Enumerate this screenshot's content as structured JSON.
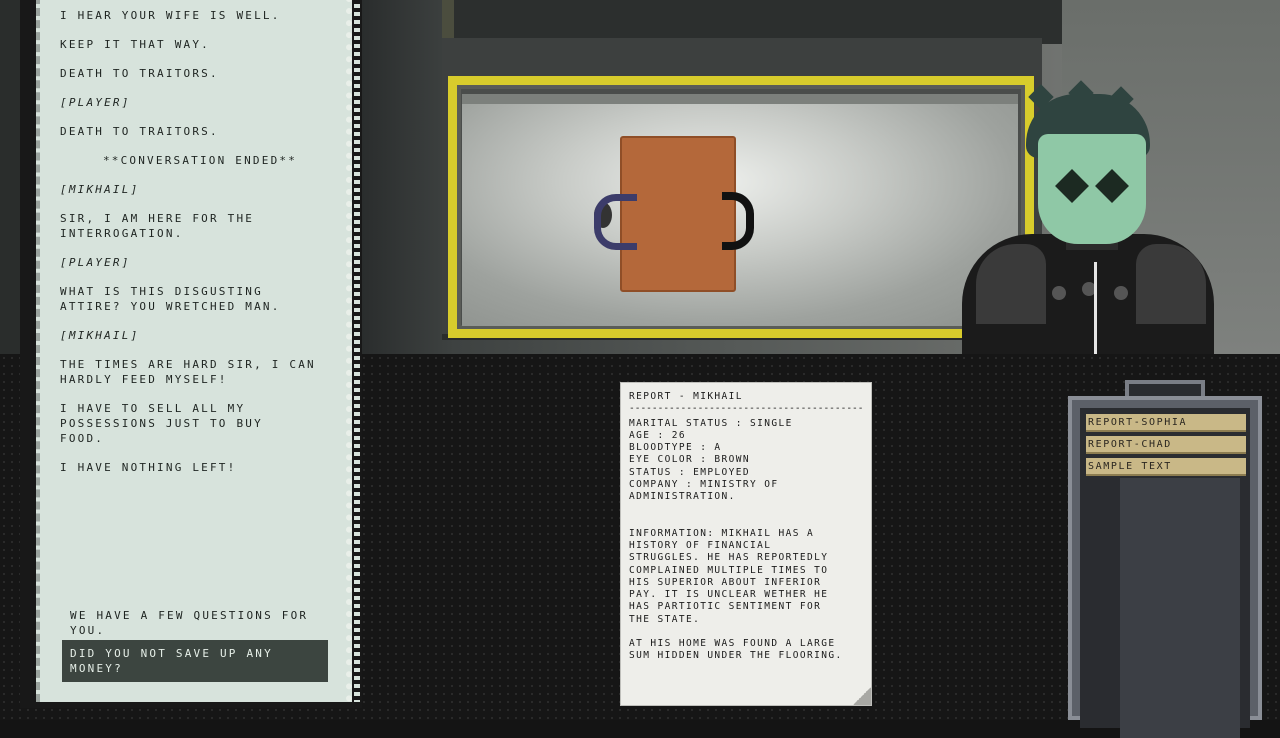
{
  "dialogue": {
    "lines": [
      {
        "text": "I hear your wife is well.",
        "style": "normal"
      },
      {
        "text": "Keep it that way.",
        "style": "normal"
      },
      {
        "text": "Death to traitors.",
        "style": "normal"
      },
      {
        "text": "[PLAYER]",
        "style": "ital"
      },
      {
        "text": "Death to traitors.",
        "style": "normal"
      },
      {
        "text": "**CONVERSATION ENDED**",
        "style": "center"
      },
      {
        "text": "[MIKHAIL]",
        "style": "ital"
      },
      {
        "text": "Sir, I am here for the\ninterrogation.",
        "style": "normal"
      },
      {
        "text": "[PLAYER]",
        "style": "ital"
      },
      {
        "text": "What is this disgusting\nattire? You wretched man.",
        "style": "normal"
      },
      {
        "text": "[MIKHAIL]",
        "style": "ital"
      },
      {
        "text": "The times are hard sir, I can\nhardly feed myself!",
        "style": "normal"
      },
      {
        "text": "I have to sell all my\npossessions just to buy\nfood.",
        "style": "normal"
      },
      {
        "text": "I have nothing left!",
        "style": "normal"
      }
    ],
    "options": [
      {
        "text": "We have a few questions\nfor you.",
        "selected": false
      },
      {
        "text": "Did you not save up any\nmoney?",
        "selected": true
      }
    ]
  },
  "report": {
    "title": "REPORT - MIKHAIL",
    "divider": "------------------------------------------",
    "fields": "MARITAL STATUS : SINGLE\nAGE : 26\nBLOODTYPE : A\nEYE COLOR : BROWN\nSTATUS : EMPLOYED\nCOMPANY : MINISTRY OF\nADMINISTRATION.",
    "information": "INFORMATION: MIKHAIL HAS A\nHISTORY OF FINANCIAL\nSTRUGGLES. HE HAS REPORTEDLY\nCOMPLAINED MULTIPLE TIMES TO\nHIS SUPERIOR ABOUT INFERIOR\nPAY. IT IS UNCLEAR WETHER HE\nHAS PARTIOTIC SENTIMENT FOR\nTHE STATE.",
    "home": "AT HIS HOME WAS FOUND A LARGE\nSUM HIDDEN UNDER THE FLOORING."
  },
  "cabinet": {
    "folders": [
      "REPORT-SOPHIA",
      "REPORT-CHAD",
      "SAMPLE TEXT"
    ]
  },
  "colors": {
    "panel": "#d7e3dc",
    "selected_option": "#3c4540",
    "table": "#b4683a",
    "frame_yellow": "#d8cc2c",
    "mask": "#8fc8a6",
    "folder": "#c9b887"
  }
}
